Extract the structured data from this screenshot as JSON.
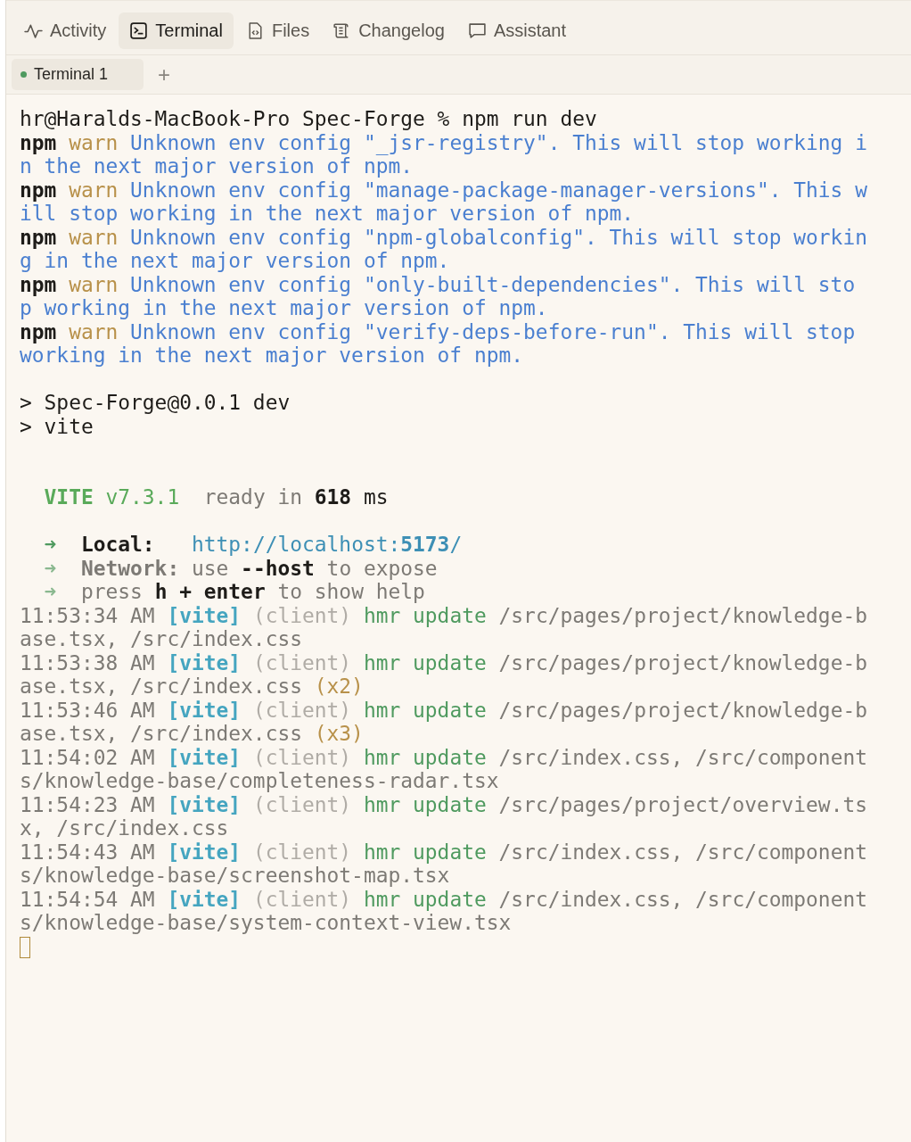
{
  "tabs": [
    {
      "label": "Activity",
      "selected": false
    },
    {
      "label": "Terminal",
      "selected": true
    },
    {
      "label": "Files",
      "selected": false
    },
    {
      "label": "Changelog",
      "selected": false
    },
    {
      "label": "Assistant",
      "selected": false
    }
  ],
  "terminal_tabs": [
    {
      "label": "Terminal 1",
      "selected": true,
      "color": "#4f9a5f"
    }
  ],
  "new_tab_button": {
    "label": "+"
  },
  "output": {
    "blocks": [
      {
        "kind": "command",
        "lines": [
          [
            {
              "kind": "plain",
              "text": "hr@Haralds-MacBook-Pro Spec-Forge % npm run dev"
            }
          ],
          [
            {
              "kind": "bold",
              "text": "npm "
            },
            {
              "kind": "warn",
              "text": "warn"
            },
            {
              "kind": "info",
              "text": " Unknown env config \"_jsr-registry\". This will stop working in the next major version of npm."
            }
          ],
          [
            {
              "kind": "bold",
              "text": "npm "
            },
            {
              "kind": "warn",
              "text": "warn"
            },
            {
              "kind": "info",
              "text": " Unknown env config \"manage-package-manager-versions\". This will stop working in the next major version of npm."
            }
          ],
          [
            {
              "kind": "bold",
              "text": "npm "
            },
            {
              "kind": "warn",
              "text": "warn"
            },
            {
              "kind": "info",
              "text": " Unknown env config \"npm-globalconfig\". This will stop working in the next major version of npm."
            }
          ],
          [
            {
              "kind": "bold",
              "text": "npm "
            },
            {
              "kind": "warn",
              "text": "warn"
            },
            {
              "kind": "info",
              "text": " Unknown env config \"only-built-dependencies\". This will stop working in the next major version of npm."
            }
          ],
          [
            {
              "kind": "bold",
              "text": "npm "
            },
            {
              "kind": "warn",
              "text": "warn"
            },
            {
              "kind": "info",
              "text": " Unknown env config \"verify-deps-before-run\". This will stop working in the next major version of npm."
            }
          ]
        ]
      },
      {
        "kind": "script",
        "lines": [
          [
            {
              "kind": "plain",
              "text": "> Spec-Forge@0.0.1 dev"
            }
          ],
          [
            {
              "kind": "plain",
              "text": "> vite"
            }
          ]
        ]
      },
      {
        "kind": "banner",
        "lines": [
          [
            {
              "kind": "brand",
              "text": "VITE "
            },
            {
              "kind": "version",
              "text": "v7.3.1"
            },
            {
              "kind": "dim",
              "text": "  ready in "
            },
            {
              "kind": "bold",
              "text": "618"
            },
            {
              "kind": "plain",
              "text": " ms"
            }
          ]
        ]
      },
      {
        "kind": "urls",
        "lines": [
          [
            {
              "kind": "arrow",
              "text": "➜  "
            },
            {
              "kind": "bold",
              "text": "Local:   "
            },
            {
              "kind": "url",
              "text": "http://localhost:"
            },
            {
              "kind": "url-bold",
              "text": "5173"
            },
            {
              "kind": "url",
              "text": "/"
            }
          ],
          [
            {
              "kind": "arrow-dim",
              "text": "➜  "
            },
            {
              "kind": "dim-bold",
              "text": "Network:"
            },
            {
              "kind": "dim",
              "text": " use "
            },
            {
              "kind": "bold",
              "text": "--host"
            },
            {
              "kind": "dim",
              "text": " to expose"
            }
          ],
          [
            {
              "kind": "arrow-dim",
              "text": "➜  "
            },
            {
              "kind": "dim",
              "text": "press "
            },
            {
              "kind": "bold",
              "text": "h + enter"
            },
            {
              "kind": "dim",
              "text": " to show help"
            }
          ]
        ]
      },
      {
        "kind": "log",
        "lines": [
          [
            {
              "kind": "dim",
              "text": "11:53:34 AM "
            },
            {
              "kind": "tag",
              "text": "[vite]"
            },
            {
              "kind": "faint",
              "text": " (client)"
            },
            {
              "kind": "hmr",
              "text": " hmr update"
            },
            {
              "kind": "dim",
              "text": " /src/pages/project/knowledge-base.tsx, /src/index.css"
            }
          ],
          [
            {
              "kind": "dim",
              "text": "11:53:38 AM "
            },
            {
              "kind": "tag",
              "text": "[vite]"
            },
            {
              "kind": "faint",
              "text": " (client)"
            },
            {
              "kind": "hmr",
              "text": " hmr update"
            },
            {
              "kind": "dim",
              "text": " /src/pages/project/knowledge-base.tsx, /src/index.css "
            },
            {
              "kind": "warn",
              "text": "(x2)"
            }
          ],
          [
            {
              "kind": "dim",
              "text": "11:53:46 AM "
            },
            {
              "kind": "tag",
              "text": "[vite]"
            },
            {
              "kind": "faint",
              "text": " (client)"
            },
            {
              "kind": "hmr",
              "text": " hmr update"
            },
            {
              "kind": "dim",
              "text": " /src/pages/project/knowledge-base.tsx, /src/index.css "
            },
            {
              "kind": "warn",
              "text": "(x3)"
            }
          ],
          [
            {
              "kind": "dim",
              "text": "11:54:02 AM "
            },
            {
              "kind": "tag",
              "text": "[vite]"
            },
            {
              "kind": "faint",
              "text": " (client)"
            },
            {
              "kind": "hmr",
              "text": " hmr update"
            },
            {
              "kind": "dim",
              "text": " /src/index.css, /src/components/knowledge-base/completeness-radar.tsx"
            }
          ],
          [
            {
              "kind": "dim",
              "text": "11:54:23 AM "
            },
            {
              "kind": "tag",
              "text": "[vite]"
            },
            {
              "kind": "faint",
              "text": " (client)"
            },
            {
              "kind": "hmr",
              "text": " hmr update"
            },
            {
              "kind": "dim",
              "text": " /src/pages/project/overview.tsx, /src/index.css"
            }
          ],
          [
            {
              "kind": "dim",
              "text": "11:54:43 AM "
            },
            {
              "kind": "tag",
              "text": "[vite]"
            },
            {
              "kind": "faint",
              "text": " (client)"
            },
            {
              "kind": "hmr",
              "text": " hmr update"
            },
            {
              "kind": "dim",
              "text": " /src/index.css, /src/components/knowledge-base/screenshot-map.tsx"
            }
          ],
          [
            {
              "kind": "dim",
              "text": "11:54:54 AM "
            },
            {
              "kind": "tag",
              "text": "[vite]"
            },
            {
              "kind": "faint",
              "text": " (client)"
            },
            {
              "kind": "hmr",
              "text": " hmr update"
            },
            {
              "kind": "dim",
              "text": " /src/index.css, /src/components/knowledge-base/system-context-view.tsx"
            }
          ]
        ]
      }
    ],
    "cursor": {
      "visible": true
    }
  }
}
